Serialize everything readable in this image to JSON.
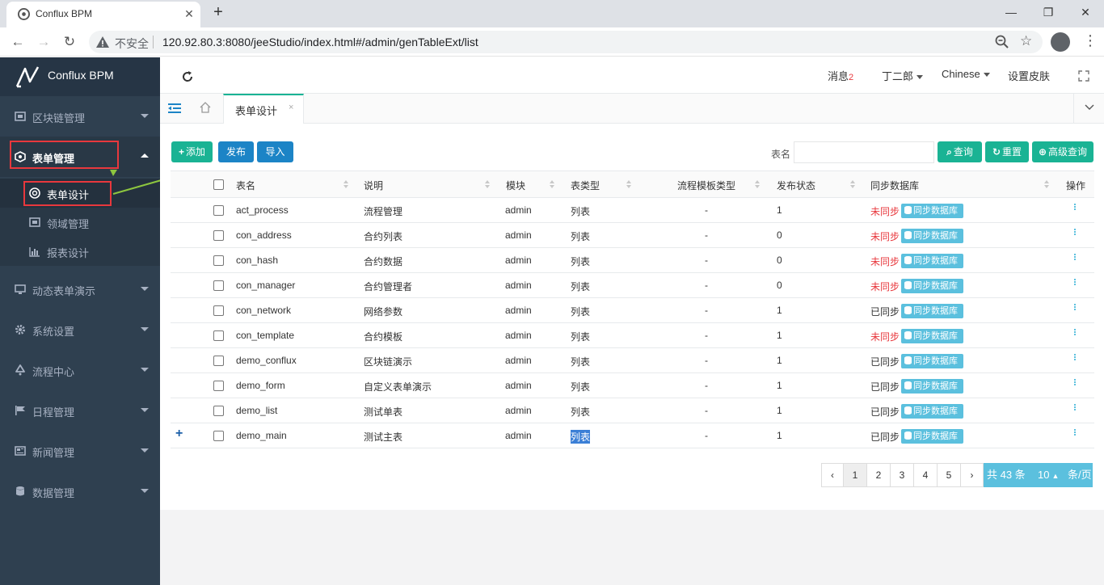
{
  "browser": {
    "tab_title": "Conflux BPM",
    "insecure_label": "不安全",
    "url": "120.92.80.3:8080/jeeStudio/index.html#/admin/genTableExt/list"
  },
  "sidebar": {
    "logo_text": "Conflux BPM",
    "menu": [
      {
        "label": "区块链管理",
        "icon": "blockchain-icon"
      },
      {
        "label": "表单管理",
        "icon": "form-icon"
      },
      {
        "label": "动态表单演示",
        "icon": "monitor-icon"
      },
      {
        "label": "系统设置",
        "icon": "gear-icon"
      },
      {
        "label": "流程中心",
        "icon": "recycle-icon"
      },
      {
        "label": "日程管理",
        "icon": "flag-icon"
      },
      {
        "label": "新闻管理",
        "icon": "newspaper-icon"
      },
      {
        "label": "数据管理",
        "icon": "database-icon"
      }
    ],
    "submenu": [
      {
        "label": "表单设计",
        "icon": "globe-icon"
      },
      {
        "label": "领域管理",
        "icon": "grid-icon"
      },
      {
        "label": "报表设计",
        "icon": "bar-chart-icon"
      }
    ]
  },
  "header": {
    "messages_label": "消息",
    "messages_count": "2",
    "user_name": "丁二郎",
    "language": "Chinese",
    "skin_label": "设置皮肤"
  },
  "page_tabs": {
    "active_tab": "表单设计",
    "close": "×"
  },
  "toolbar": {
    "add_label": "添加",
    "publish_label": "发布",
    "import_label": "导入",
    "search_label": "表名",
    "search_value": "",
    "query_label": "查询",
    "reset_label": "重置",
    "advanced_label": "高级查询"
  },
  "table": {
    "columns": [
      "表名",
      "说明",
      "模块",
      "表类型",
      "流程模板类型",
      "发布状态",
      "同步数据库",
      "操作"
    ],
    "sync_button_label": "同步数据库",
    "rows": [
      {
        "name": "act_process",
        "desc": "流程管理",
        "module": "admin",
        "type": "列表",
        "flow": "-",
        "status": "1",
        "sync": "未同步",
        "synced": false
      },
      {
        "name": "con_address",
        "desc": "合约列表",
        "module": "admin",
        "type": "列表",
        "flow": "-",
        "status": "0",
        "sync": "未同步",
        "synced": false
      },
      {
        "name": "con_hash",
        "desc": "合约数据",
        "module": "admin",
        "type": "列表",
        "flow": "-",
        "status": "0",
        "sync": "未同步",
        "synced": false
      },
      {
        "name": "con_manager",
        "desc": "合约管理者",
        "module": "admin",
        "type": "列表",
        "flow": "-",
        "status": "0",
        "sync": "未同步",
        "synced": false
      },
      {
        "name": "con_network",
        "desc": "网络参数",
        "module": "admin",
        "type": "列表",
        "flow": "-",
        "status": "1",
        "sync": "已同步",
        "synced": true
      },
      {
        "name": "con_template",
        "desc": "合约模板",
        "module": "admin",
        "type": "列表",
        "flow": "-",
        "status": "1",
        "sync": "未同步",
        "synced": false
      },
      {
        "name": "demo_conflux",
        "desc": "区块链演示",
        "module": "admin",
        "type": "列表",
        "flow": "-",
        "status": "1",
        "sync": "已同步",
        "synced": true
      },
      {
        "name": "demo_form",
        "desc": "自定义表单演示",
        "module": "admin",
        "type": "列表",
        "flow": "-",
        "status": "1",
        "sync": "已同步",
        "synced": true
      },
      {
        "name": "demo_list",
        "desc": "测试单表",
        "module": "admin",
        "type": "列表",
        "flow": "-",
        "status": "1",
        "sync": "已同步",
        "synced": true
      },
      {
        "name": "demo_main",
        "desc": "测试主表",
        "module": "admin",
        "type": "列表",
        "flow": "-",
        "status": "1",
        "sync": "已同步",
        "synced": true
      }
    ]
  },
  "pagination": {
    "prev": "‹",
    "next": "›",
    "pages": [
      "1",
      "2",
      "3",
      "4",
      "5"
    ],
    "current_page": "1",
    "total_text": "共 43 条",
    "page_size": "10",
    "per_page_label": "条/页"
  },
  "colors": {
    "sidebar_bg": "#2f4050",
    "primary_green": "#1ab394",
    "primary_blue": "#1c84c6",
    "info": "#5bc0de",
    "danger": "#e8383d"
  }
}
